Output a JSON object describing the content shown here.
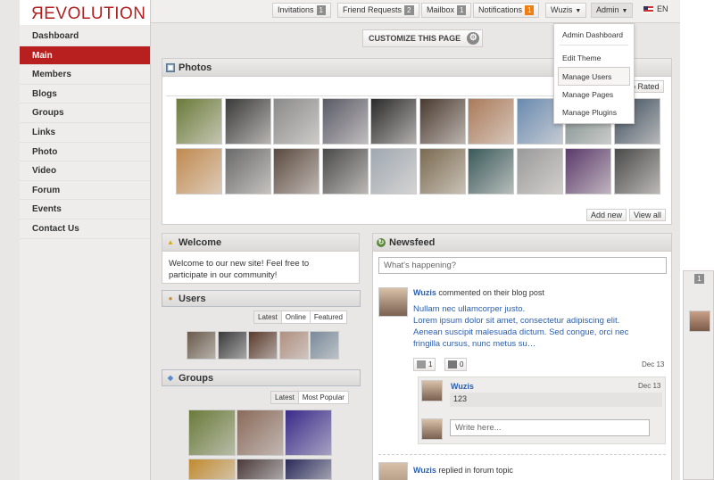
{
  "logo": {
    "text_r": "Я",
    "text_rest": "EVOLUTION"
  },
  "sidebar": {
    "items": [
      {
        "label": "Dashboard",
        "active": false
      },
      {
        "label": "Main",
        "active": true
      },
      {
        "label": "Members",
        "active": false
      },
      {
        "label": "Blogs",
        "active": false
      },
      {
        "label": "Groups",
        "active": false
      },
      {
        "label": "Links",
        "active": false
      },
      {
        "label": "Photo",
        "active": false
      },
      {
        "label": "Video",
        "active": false
      },
      {
        "label": "Forum",
        "active": false
      },
      {
        "label": "Events",
        "active": false
      },
      {
        "label": "Contact Us",
        "active": false
      }
    ]
  },
  "topbar": {
    "invitations": {
      "label": "Invitations",
      "count": "1"
    },
    "friend_requests": {
      "label": "Friend Requests",
      "count": "2"
    },
    "mailbox": {
      "label": "Mailbox",
      "count": "1"
    },
    "notifications": {
      "label": "Notifications",
      "count": "1"
    },
    "user": "Wuzis",
    "admin": "Admin",
    "language": "EN"
  },
  "admin_menu": {
    "items": [
      "Admin Dashboard",
      "Edit Theme",
      "Manage Users",
      "Manage Pages",
      "Manage Plugins"
    ]
  },
  "customize": {
    "label": "CUSTOMIZE THIS PAGE"
  },
  "photos": {
    "title": "Photos",
    "top_rated": "p Rated",
    "add_new": "Add new",
    "view_all": "View all",
    "colors": [
      "#6b7a3a",
      "#3a3a3a",
      "#8a8a8a",
      "#5a5a66",
      "#2a2a2a",
      "#4a3a30",
      "#aa7a5a",
      "#6a8ab0",
      "#7a8a8a",
      "#3a4a5a",
      "#c08a50",
      "#6a6a6a",
      "#5a4a40",
      "#4a4a4a",
      "#a0a8b0",
      "#7a6a50",
      "#3a5a5a",
      "#9a9a9a",
      "#5a3a6a",
      "#4a4a4a"
    ]
  },
  "welcome": {
    "title": "Welcome",
    "text_line1": "Welcome to our new site! Feel free to",
    "text_line2": "participate in our community!"
  },
  "users": {
    "title": "Users",
    "tabs": [
      "Latest",
      "Online",
      "Featured"
    ],
    "colors": [
      "#6a5a4a",
      "#3a3a3a",
      "#5a3a2a",
      "#b09080",
      "#7a8a9a"
    ]
  },
  "groups": {
    "title": "Groups",
    "tabs": [
      "Latest",
      "Most Popular"
    ],
    "colors": [
      "#6b7a3a",
      "#8a6a5a",
      "#3a2a8a",
      "#c08a30",
      "#4a3a3a",
      "#2a2a5a"
    ]
  },
  "newsfeed": {
    "title": "Newsfeed",
    "placeholder": "What's happening?",
    "post1": {
      "user": "Wuzis",
      "action": "commented on their blog post",
      "link": "Nullam nec ullamcorper justo.",
      "body_line1": "Lorem ipsum dolor sit amet, consectetur adipiscing elit.",
      "body_line2": "Aenean suscipit malesuada dictum. Sed congue, orci nec",
      "body_line3": "fringilla cursus, nunc metus su…",
      "comments": "1",
      "likes": "0",
      "date": "Dec 13"
    },
    "comment": {
      "user": "Wuzis",
      "text": "123",
      "date": "Dec 13"
    },
    "reply_placeholder": "Write here...",
    "post2": {
      "user": "Wuzis",
      "action": "replied in forum topic"
    }
  },
  "right_panel": {
    "count": "1"
  },
  "theme": {
    "accent": "#b8201f",
    "link": "#2c5eab",
    "badge": "#8d8d8d",
    "badge_orange": "#f07d12"
  }
}
